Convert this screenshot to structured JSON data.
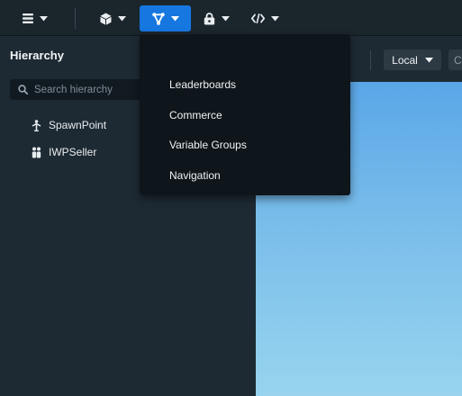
{
  "toolbar": {
    "buttons": [
      {
        "icon": "hamburger-menu-icon"
      },
      {
        "icon": "cube-icon"
      },
      {
        "icon": "fork-branches-icon",
        "active": true
      },
      {
        "icon": "lock-bag-icon"
      },
      {
        "icon": "code-icon"
      }
    ],
    "active_color": "#1677e0"
  },
  "hierarchy": {
    "title": "Hierarchy",
    "search_placeholder": "Search hierarchy",
    "items": [
      {
        "label": "SpawnPoint",
        "icon": "spawn-point-icon"
      },
      {
        "label": "IWPSeller",
        "icon": "seller-icon"
      }
    ]
  },
  "viewport": {
    "space_mode": "Local",
    "next_dropdown_label": "C"
  },
  "dropdown_menu": {
    "items": [
      {
        "label": "Leaderboards"
      },
      {
        "label": "Commerce"
      },
      {
        "label": "Variable Groups"
      },
      {
        "label": "Navigation"
      }
    ]
  }
}
